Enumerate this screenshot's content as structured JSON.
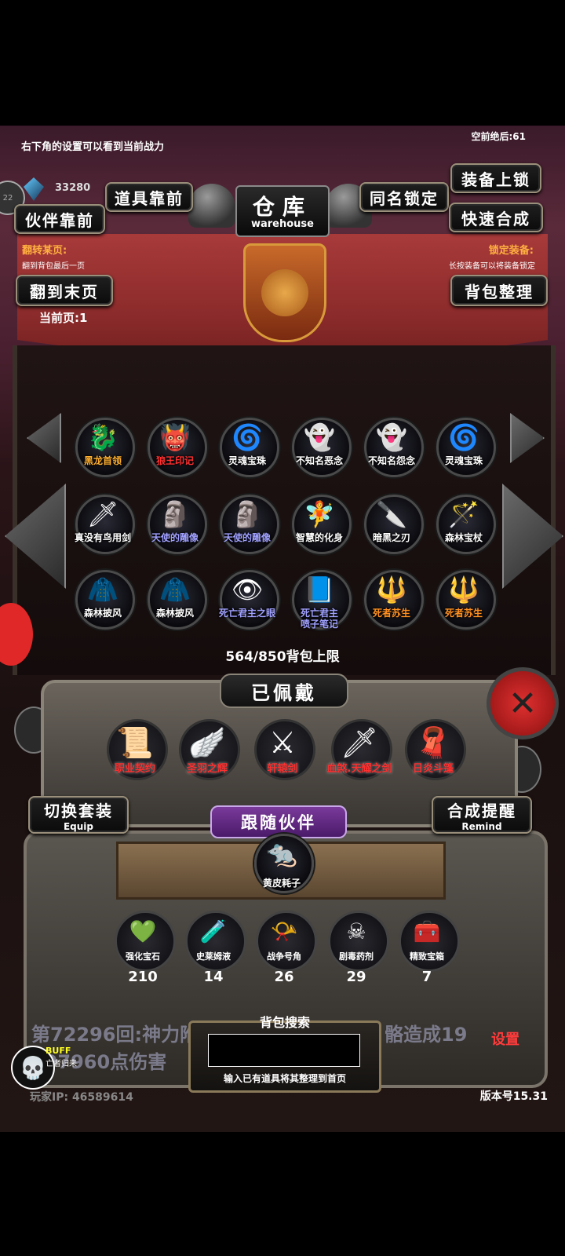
{
  "hud": {
    "hint_top": "右下角的设置可以看到当前战力",
    "counter_top": "空前绝后:61",
    "gem_value": "33280",
    "left_circle": "22"
  },
  "buttons": {
    "items_front": "道具靠前",
    "partner_front": "伙伴靠前",
    "same_name_lock": "同名锁定",
    "equip_lock": "装备上锁",
    "quick_merge": "快速合成",
    "to_last_page": "翻到末页",
    "bag_sort": "背包整理",
    "switch_set": "切换套装",
    "switch_set_en": "Equip",
    "merge_remind": "合成提醒",
    "merge_remind_en": "Remind"
  },
  "title": {
    "cn": "仓库",
    "en": "warehouse"
  },
  "info": {
    "left_title": "翻转某页:",
    "left_sub": "翻到背包最后一页",
    "right_title": "锁定装备:",
    "right_sub": "长按装备可以将装备锁定",
    "current_page": "当前页:1"
  },
  "bag_items": [
    {
      "label": "黑龙首领",
      "icon": "dragon-icon",
      "glyph": "🐉",
      "color": "#ffb030"
    },
    {
      "label": "狼王印记",
      "icon": "wolf-mark-icon",
      "glyph": "👹",
      "color": "#ff3030"
    },
    {
      "label": "灵魂宝珠",
      "icon": "soul-orb-icon",
      "glyph": "🌀",
      "color": "#ffffff"
    },
    {
      "label": "不知名恶念",
      "icon": "spirit-icon",
      "glyph": "👻",
      "color": "#ffffff"
    },
    {
      "label": "不知名怨念",
      "icon": "ghost-icon",
      "glyph": "👻",
      "color": "#ffffff"
    },
    {
      "label": "灵魂宝珠",
      "icon": "soul-orb-icon",
      "glyph": "🌀",
      "color": "#ffffff"
    },
    {
      "label": "真没有鸟用剑",
      "icon": "sword-icon",
      "glyph": "🗡",
      "color": "#ffffff"
    },
    {
      "label": "天使的雕像",
      "icon": "statue-icon",
      "glyph": "🗿",
      "color": "#a0a0ff"
    },
    {
      "label": "天使的雕像",
      "icon": "statue-icon",
      "glyph": "🗿",
      "color": "#a0a0ff"
    },
    {
      "label": "智慧的化身",
      "icon": "sage-icon",
      "glyph": "🧚",
      "color": "#ffffff"
    },
    {
      "label": "暗黑之刃",
      "icon": "dark-blade-icon",
      "glyph": "🔪",
      "color": "#ffffff"
    },
    {
      "label": "森林宝杖",
      "icon": "staff-icon",
      "glyph": "🪄",
      "color": "#ffffff"
    },
    {
      "label": "森林披风",
      "icon": "cloak-icon",
      "glyph": "🧥",
      "color": "#ffffff"
    },
    {
      "label": "森林披风",
      "icon": "cloak-icon",
      "glyph": "🧥",
      "color": "#ffffff"
    },
    {
      "label": "死亡君主之眼",
      "icon": "eye-icon",
      "glyph": "👁",
      "color": "#a0a0ff"
    },
    {
      "label": "死亡君主\n喷子笔记",
      "icon": "book-icon",
      "glyph": "📘",
      "color": "#a0a0ff"
    },
    {
      "label": "死者苏生",
      "icon": "resurrect-icon",
      "glyph": "🔱",
      "color": "#ff9020"
    },
    {
      "label": "死者苏生",
      "icon": "resurrect-icon",
      "glyph": "🔱",
      "color": "#ff9020"
    }
  ],
  "capacity": "564/850背包上限",
  "equipped": {
    "title": "已佩戴",
    "items": [
      {
        "label": "职业契约",
        "icon": "scroll-icon",
        "glyph": "📜"
      },
      {
        "label": "圣羽之辉",
        "icon": "wings-icon",
        "glyph": "🪽"
      },
      {
        "label": "轩辕剑",
        "icon": "sword-icon",
        "glyph": "⚔"
      },
      {
        "label": "血煞.天耀之剑",
        "icon": "blade-icon",
        "glyph": "🗡"
      },
      {
        "label": "日炎斗篷",
        "icon": "cape-icon",
        "glyph": "🧣"
      }
    ]
  },
  "follow": {
    "title": "跟随伙伴",
    "partner": {
      "label": "黄皮耗子",
      "icon": "rat-icon",
      "glyph": "🐀"
    }
  },
  "consumables": [
    {
      "label": "强化宝石",
      "icon": "gem-icon",
      "glyph": "💚",
      "count": "210"
    },
    {
      "label": "史莱姆液",
      "icon": "potion-icon",
      "glyph": "🧪",
      "count": "14"
    },
    {
      "label": "战争号角",
      "icon": "horn-icon",
      "glyph": "📯",
      "count": "26"
    },
    {
      "label": "剧毒药剂",
      "icon": "poison-icon",
      "glyph": "☠",
      "count": "29"
    },
    {
      "label": "精致宝箱",
      "icon": "chest-icon",
      "glyph": "🧰",
      "count": "7"
    }
  ],
  "battle_log": {
    "line1": "第72296回:神力附",
    "line1b": "骼造成19",
    "line2": "397960点伤害"
  },
  "search": {
    "title": "背包搜索",
    "hint": "输入已有道具将其整理到首页"
  },
  "buff": {
    "label": "BUFF",
    "sub": "亡者归来"
  },
  "footer": {
    "player_ip": "玩家IP: 46589614",
    "version": "版本号15.31",
    "settings": "设置"
  }
}
